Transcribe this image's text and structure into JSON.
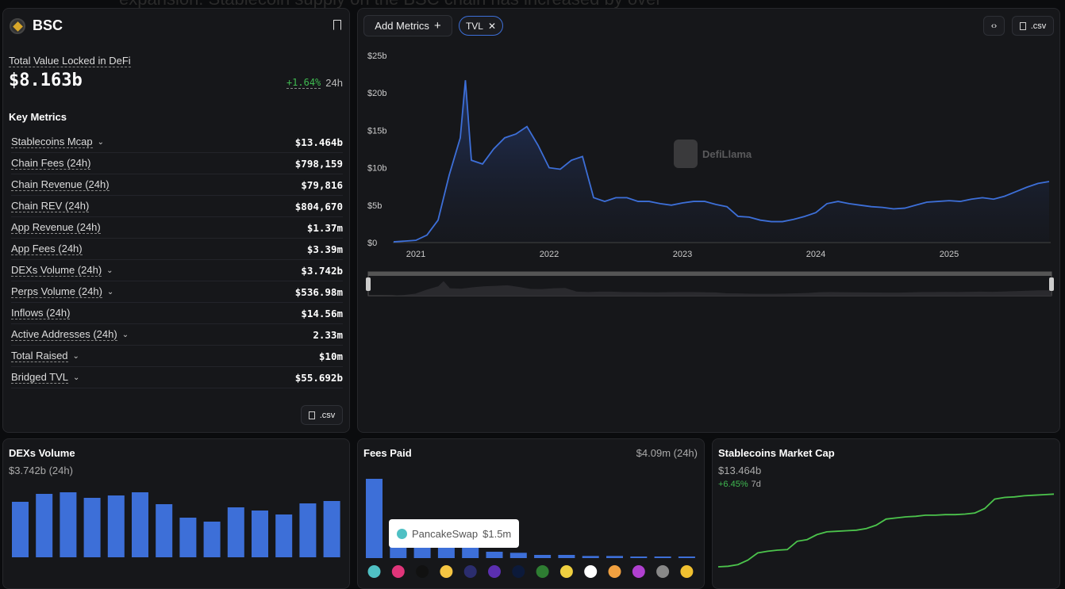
{
  "bg_text": "expansion. Stablecoin supply on the BSC chain has increased by over",
  "chain": {
    "name": "BSC",
    "icon": "bsc-logo-icon"
  },
  "tvl": {
    "label": "Total Value Locked in DeFi",
    "value": "$8.163b",
    "change": "+1.64%",
    "period": "24h"
  },
  "key_metrics": {
    "title": "Key Metrics",
    "items": [
      {
        "label": "Stablecoins Mcap",
        "value": "$13.464b",
        "expand": true
      },
      {
        "label": "Chain Fees (24h)",
        "value": "$798,159",
        "expand": false
      },
      {
        "label": "Chain Revenue (24h)",
        "value": "$79,816",
        "expand": false
      },
      {
        "label": "Chain REV (24h)",
        "value": "$804,670",
        "expand": false
      },
      {
        "label": "App Revenue (24h)",
        "value": "$1.37m",
        "expand": false
      },
      {
        "label": "App Fees (24h)",
        "value": "$3.39m",
        "expand": false
      },
      {
        "label": "DEXs Volume (24h)",
        "value": "$3.742b",
        "expand": true
      },
      {
        "label": "Perps Volume (24h)",
        "value": "$536.98m",
        "expand": true
      },
      {
        "label": "Inflows (24h)",
        "value": "$14.56m",
        "expand": false
      },
      {
        "label": "Active Addresses (24h)",
        "value": "2.33m",
        "expand": true
      },
      {
        "label": "Total Raised",
        "value": "$10m",
        "expand": true
      },
      {
        "label": "Bridged TVL",
        "value": "$55.692b",
        "expand": true
      }
    ],
    "csv": ".csv"
  },
  "toolbar": {
    "add_metrics": "Add Metrics",
    "tvl_chip": "TVL",
    "csv": ".csv",
    "embed_icon": "code-icon"
  },
  "watermark": "DefiLlama",
  "colors": {
    "accent": "#2172e5",
    "line": "#3d6fd8",
    "positive": "#3fb950",
    "stable_line": "#4cc44c"
  },
  "chart_data": [
    {
      "type": "area",
      "series_name": "TVL",
      "ylim": [
        0,
        25
      ],
      "yticks": [
        "$0",
        "$5b",
        "$10b",
        "$15b",
        "$20b",
        "$25b"
      ],
      "ytick_values": [
        0,
        5,
        10,
        15,
        20,
        25
      ],
      "xticks": [
        "2021",
        "2022",
        "2023",
        "2024",
        "2025"
      ],
      "x": [
        "2020-11",
        "2020-12",
        "2021-01",
        "2021-02",
        "2021-03",
        "2021-04",
        "2021-05",
        "2021-05-15",
        "2021-06",
        "2021-07",
        "2021-08",
        "2021-09",
        "2021-10",
        "2021-11",
        "2021-12",
        "2022-01",
        "2022-02",
        "2022-03",
        "2022-04",
        "2022-05",
        "2022-06",
        "2022-07",
        "2022-08",
        "2022-09",
        "2022-10",
        "2022-11",
        "2022-12",
        "2023-01",
        "2023-02",
        "2023-03",
        "2023-04",
        "2023-05",
        "2023-06",
        "2023-07",
        "2023-08",
        "2023-09",
        "2023-10",
        "2023-11",
        "2023-12",
        "2024-01",
        "2024-02",
        "2024-03",
        "2024-04",
        "2024-05",
        "2024-06",
        "2024-07",
        "2024-08",
        "2024-09",
        "2024-10",
        "2024-11",
        "2024-12",
        "2025-01",
        "2025-02",
        "2025-03",
        "2025-04",
        "2025-05",
        "2025-06",
        "2025-07",
        "2025-08",
        "2025-09",
        "2025-10"
      ],
      "y": [
        0.1,
        0.2,
        0.3,
        1,
        3,
        9,
        14,
        21.7,
        11,
        10.5,
        12.5,
        14,
        14.5,
        15.5,
        13,
        10,
        9.8,
        11,
        11.5,
        6,
        5.5,
        6,
        6,
        5.5,
        5.5,
        5.2,
        5,
        5.3,
        5.5,
        5.5,
        5.1,
        4.8,
        3.5,
        3.4,
        3,
        2.8,
        2.8,
        3.1,
        3.5,
        4,
        5.2,
        5.5,
        5.2,
        5,
        4.8,
        4.7,
        4.5,
        4.6,
        5,
        5.4,
        5.5,
        5.6,
        5.5,
        5.8,
        6,
        5.8,
        6.2,
        6.8,
        7.4,
        7.9,
        8.16
      ]
    },
    {
      "type": "bar",
      "title": "DEXs Volume",
      "subtitle": "$3.742b (24h)",
      "values": [
        70,
        80,
        82,
        75,
        78,
        82,
        67,
        50,
        45,
        63,
        59,
        54,
        68,
        71
      ]
    },
    {
      "type": "bar",
      "title": "Fees Paid",
      "total": "$4.09m (24h)",
      "unit": "$m",
      "tooltip": {
        "name": "PancakeSwap",
        "value": "$1.5m"
      },
      "values": [
        1.5,
        0.33,
        0.33,
        0.33,
        0.33,
        0.12,
        0.1,
        0.06,
        0.06,
        0.04,
        0.04,
        0.03,
        0.03,
        0.02
      ],
      "icon_colors": [
        "#4fc0c4",
        "#e0357a",
        "#111",
        "#f5c542",
        "#2b2d6e",
        "#5b2fb0",
        "#0c1a3a",
        "#2e7d32",
        "#f0d040",
        "#fff",
        "#f0a040",
        "#b040d0",
        "#888",
        "#f0c030"
      ]
    },
    {
      "type": "line",
      "title": "Stablecoins Market Cap",
      "value": "$13.464b",
      "change": "+6.45%",
      "period": "7d",
      "values": [
        1,
        1.1,
        1.4,
        2.2,
        3.5,
        3.8,
        4,
        4.1,
        5.6,
        5.9,
        6.8,
        7.3,
        7.4,
        7.5,
        7.6,
        7.9,
        8.5,
        9.6,
        9.8,
        10,
        10.1,
        10.3,
        10.3,
        10.4,
        10.4,
        10.5,
        10.7,
        11.5,
        13.2,
        13.5,
        13.6,
        13.8,
        13.9,
        14,
        14.1
      ]
    }
  ]
}
